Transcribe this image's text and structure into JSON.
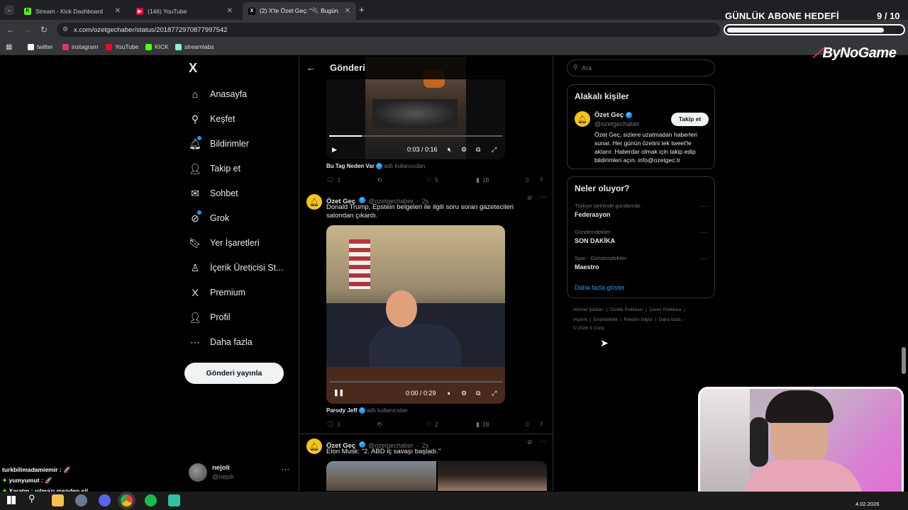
{
  "browser": {
    "tabs": [
      {
        "title": "Stream - Kick Dashboard",
        "fav_color": "#53fc18",
        "fav_letter": "K"
      },
      {
        "title": "(146) YouTube",
        "fav_color": "#ff0033",
        "fav_letter": "▶"
      },
      {
        "title": "(2) X'te Özet Geç: \"🔌 Bugün...\"",
        "fav_color": "#ffffff",
        "fav_letter": "X"
      }
    ],
    "new_tab_symbol": "+",
    "url": "x.com/ozetgechaber/status/2018772970877997542",
    "bookmarks": [
      {
        "label": "twitter",
        "color": "#ffffff"
      },
      {
        "label": "instagram",
        "color": "#e1306c"
      },
      {
        "label": "YouTube",
        "color": "#ff0033"
      },
      {
        "label": "KICK",
        "color": "#53fc18"
      },
      {
        "label": "streamlabs",
        "color": "#80f5d2"
      }
    ]
  },
  "overlay": {
    "goal_title": "GÜNLÜK ABONE HEDEFİ",
    "goal_count": "9  / 10",
    "goal_progress": 0.9,
    "brand": "ByNoGame"
  },
  "x_nav": {
    "logo": "X",
    "items": [
      {
        "label": "Anasayfa",
        "icon": "home-icon",
        "glyph": "⌂"
      },
      {
        "label": "Keşfet",
        "icon": "search-icon",
        "glyph": "⚲"
      },
      {
        "label": "Bildirimler",
        "icon": "bell-icon",
        "glyph": "🔔︎"
      },
      {
        "label": "Takip et",
        "icon": "add-person-icon",
        "glyph": "👤︎"
      },
      {
        "label": "Sohbet",
        "icon": "mail-icon",
        "glyph": "✉"
      },
      {
        "label": "Grok",
        "icon": "grok-icon",
        "glyph": "⊘"
      },
      {
        "label": "Yer İşaretleri",
        "icon": "bookmark-icon",
        "glyph": "🔖︎"
      },
      {
        "label": "İçerik Üreticisi St...",
        "icon": "creator-icon",
        "glyph": "♙"
      },
      {
        "label": "Premium",
        "icon": "x-premium-icon",
        "glyph": "X"
      },
      {
        "label": "Profil",
        "icon": "profile-icon",
        "glyph": "👤︎"
      },
      {
        "label": "Daha fazla",
        "icon": "more-circle-icon",
        "glyph": "⋯"
      }
    ],
    "post_button": "Gönderi yayınla",
    "user": {
      "name": "nejoli",
      "handle": "@nejoli",
      "more": "···"
    }
  },
  "feed": {
    "header_title": "Gönderi",
    "video1": {
      "time": "0:03 / 0:16",
      "progress": 0.19
    },
    "attribution1": {
      "name": "Bu Tag Neden Var",
      "suffix": "adlı kullanıcıdan"
    },
    "actions1": {
      "replies": "1",
      "reposts": "",
      "likes": "5",
      "views": "1B"
    },
    "tweet2": {
      "name": "Özet Geç",
      "handle": "@ozetgechaber",
      "time": "2s",
      "text": "Donald Trump, Epstein belgeleri ile ilgili soru soran gazetecileri salondan çıkardı."
    },
    "video2": {
      "time": "0:00 / 0:29",
      "progress": 0.0
    },
    "attribution2": {
      "name": "Parody Jeff",
      "suffix": "adlı kullanıcıdan"
    },
    "actions2": {
      "replies": "1",
      "reposts": "",
      "likes": "2",
      "views": "1B"
    },
    "tweet3": {
      "name": "Özet Geç",
      "handle": "@ozetgechaber",
      "time": "2s",
      "text": "Elon Musk: \"2. ABD iç savaşı başladı.\""
    }
  },
  "right": {
    "search_placeholder": "Ara",
    "related": {
      "title": "Alakalı kişiler",
      "name": "Özet Geç",
      "handle": "@ozetgechaber",
      "follow": "Takip et",
      "bio": "Özet Geç, sizlere uzatmadan haberleri sunar. Her günün özetini tek tweet'le aktarır. Haberdar olmak için takip edip bildirimleri açın. info@ozetgec.tr"
    },
    "trends": {
      "title": "Neler oluyor?",
      "items": [
        {
          "category": "Türkiye tarihinde gündemde",
          "name": "Federasyon"
        },
        {
          "category": "Gündemdekiler",
          "name": "SON DAKİKA"
        },
        {
          "category": "Spor · Gündemdekiler",
          "name": "Maestro"
        }
      ],
      "show_more": "Daha fazla göster"
    },
    "footer": {
      "line1": [
        "Hizmet Şartları",
        "Gizlilik Politikası",
        "Çerez Politikası"
      ],
      "line2": [
        "Imprint",
        "Erişilebilirlik",
        "Reklam bilgisi",
        "Daha fazla ···"
      ],
      "copyright": "© 2026 X Corp."
    }
  },
  "chat": [
    {
      "user": "turkbilimadamiemir",
      "msg": ": 🚀",
      "color": "#ffffff"
    },
    {
      "user": "yumyumut",
      "msg": ": 🚀",
      "color": "#ffffff"
    },
    {
      "user": "Xaratm",
      "msg": ": yılmazı msnden sil",
      "color": "#ffffff"
    }
  ],
  "taskbar": {
    "date": "4.02.2026"
  }
}
